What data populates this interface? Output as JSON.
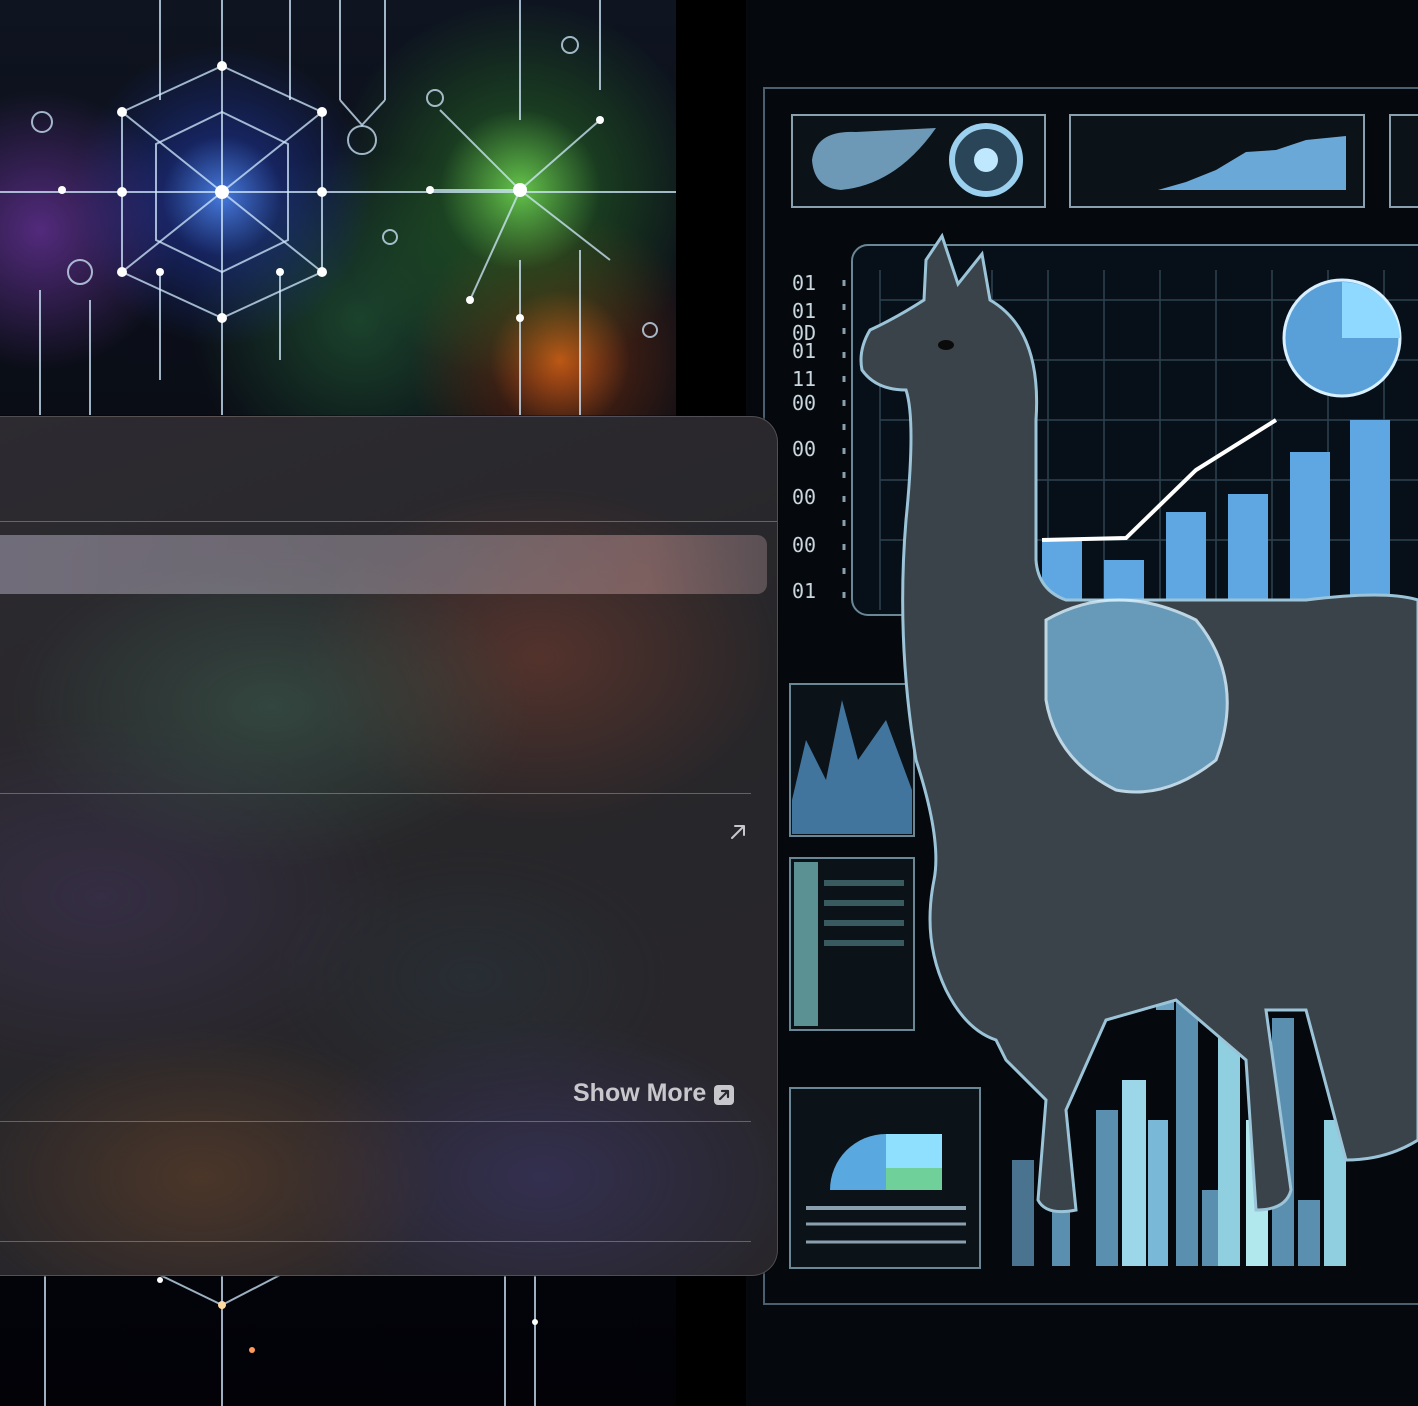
{
  "panel": {
    "show_more": {
      "label": "Show More",
      "icon": "external-square-arrow-icon"
    },
    "external_link_icon": "arrow-up-right-icon",
    "selected_row_label": ""
  },
  "artwork": {
    "right_side_digits": [
      "01",
      "01",
      "0D",
      "01",
      "11",
      "00",
      "00",
      "00",
      "00",
      "01"
    ]
  }
}
